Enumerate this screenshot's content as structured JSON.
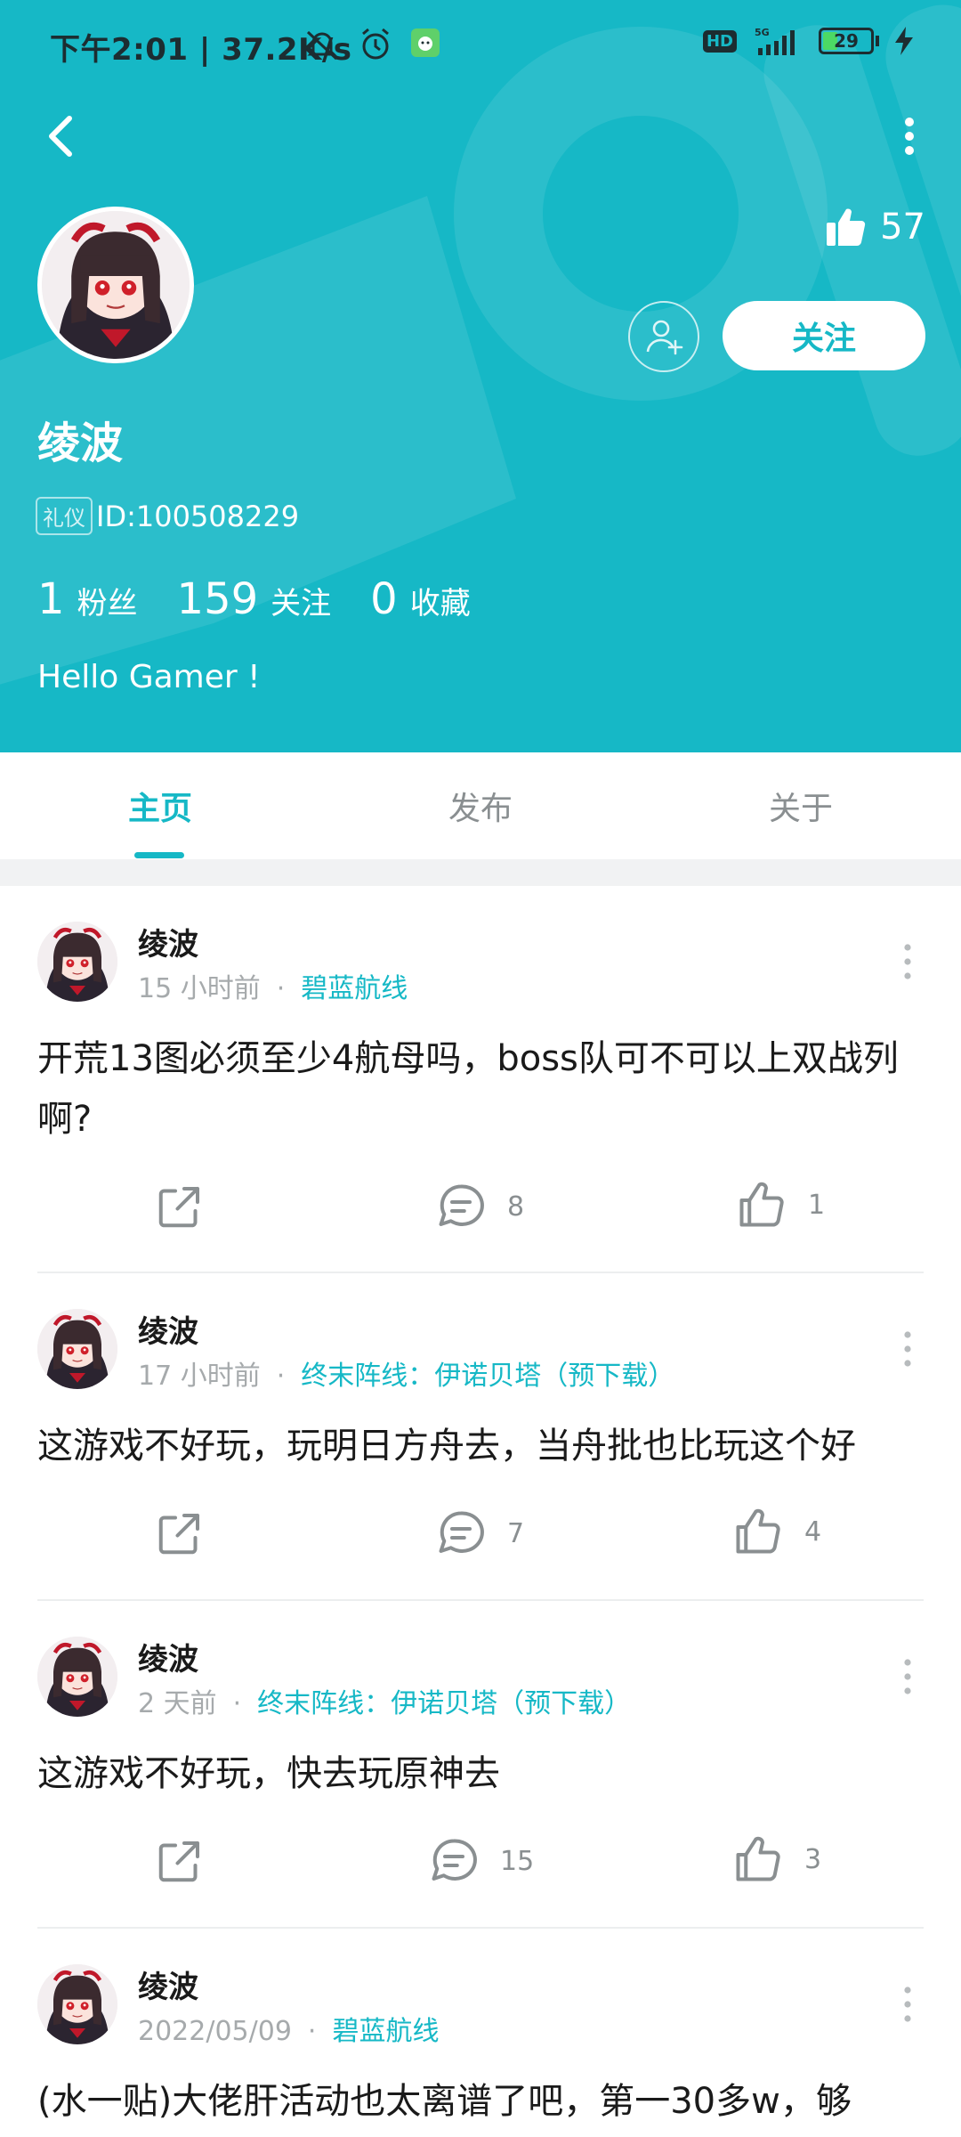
{
  "status_bar": {
    "left_text": "下午2:01 | 37.2K/s",
    "hd_badge": "HD",
    "network": "5G",
    "battery": "29"
  },
  "profile": {
    "likes_count": "57",
    "follow_button": "关注",
    "name": "绫波",
    "tag": "礼仪",
    "id_text": "ID:100508229",
    "stats": [
      {
        "num": "1",
        "label": "粉丝"
      },
      {
        "num": "159",
        "label": "关注"
      },
      {
        "num": "0",
        "label": "收藏"
      }
    ],
    "bio": "Hello Gamer !"
  },
  "tabs": [
    {
      "label": "主页",
      "active": true
    },
    {
      "label": "发布",
      "active": false
    },
    {
      "label": "关于",
      "active": false
    }
  ],
  "posts": [
    {
      "author": "绫波",
      "time": "15 小时前",
      "dot": "·",
      "game": "碧蓝航线",
      "text": "开荒13图必须至少4航母吗，boss队可不可以上双战列啊?",
      "comments": "8",
      "likes": "1"
    },
    {
      "author": "绫波",
      "time": "17 小时前",
      "dot": "·",
      "game": "终末阵线：伊诺贝塔（预下载）",
      "text": "这游戏不好玩，玩明日方舟去，当舟批也比玩这个好",
      "comments": "7",
      "likes": "4"
    },
    {
      "author": "绫波",
      "time": "2 天前",
      "dot": "·",
      "game": "终末阵线：伊诺贝塔（预下载）",
      "text": "这游戏不好玩，快去玩原神去",
      "comments": "15",
      "likes": "3"
    },
    {
      "author": "绫波",
      "time": "2022/05/09",
      "dot": "·",
      "game": "碧蓝航线",
      "text": "(水一贴)大佬肝活动也太离谱了吧，第一30多w，够",
      "comments": "",
      "likes": ""
    }
  ],
  "icons": {
    "back": "chevron-left-icon",
    "more": "more-vertical-icon",
    "like": "thumbs-up-icon",
    "add_friend": "add-user-icon",
    "share": "share-icon",
    "comment": "comment-icon"
  },
  "colors": {
    "accent": "#16b8c6",
    "text_dark": "#1a1a1a",
    "text_muted": "#a6aaac"
  }
}
